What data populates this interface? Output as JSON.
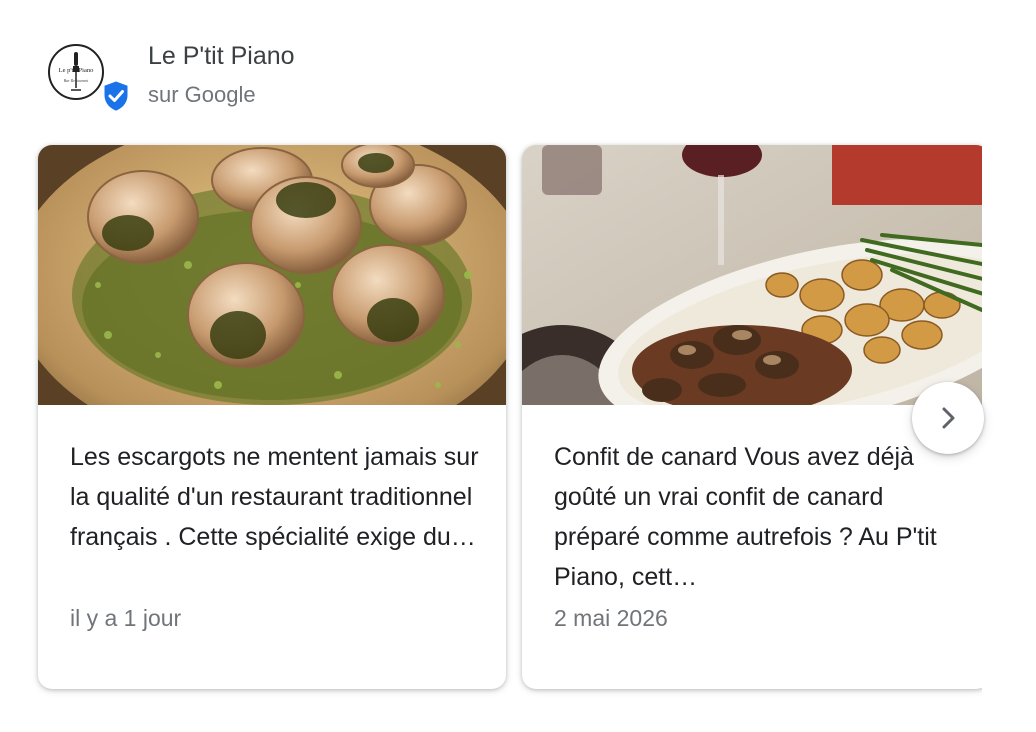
{
  "business": {
    "name": "Le P'tit Piano",
    "source": "sur Google",
    "logo_text": "Le p'tit Piano",
    "logo_script": "Bar Restaurant",
    "verified_color": "#1a73e8"
  },
  "posts": [
    {
      "image_icon": "snails-dish-photo",
      "text": "Les escargots ne mentent jamais sur la qualité d'un restaurant traditionnel français . Cette spécialité exige du…",
      "date": "il y a 1 jour"
    },
    {
      "image_icon": "duck-confit-plate-photo",
      "text": "Confit de canard Vous avez déjà goûté un vrai confit de canard préparé comme autrefois ? Au P'tit Piano, cett…",
      "date": "2 mai 2026"
    }
  ],
  "carousel": {
    "next_icon": "chevron-right-icon"
  }
}
